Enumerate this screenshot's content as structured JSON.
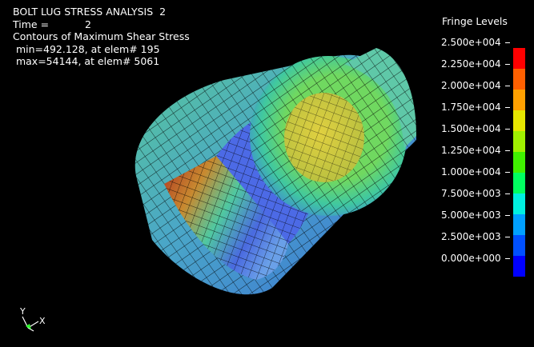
{
  "header": {
    "title": "BOLT LUG STRESS ANALYSIS  2",
    "time_label": "Time =",
    "time_value": "2",
    "contour_label": "Contours of Maximum Shear Stress",
    "min_text": " min=492.128, at elem# 195",
    "max_text": " max=54144, at elem# 5061"
  },
  "legend": {
    "title": "Fringe Levels",
    "levels": [
      "2.500e+004",
      "2.250e+004",
      "2.000e+004",
      "1.750e+004",
      "1.500e+004",
      "1.250e+004",
      "1.000e+004",
      "7.500e+003",
      "5.000e+003",
      "2.500e+003",
      "0.000e+000"
    ],
    "colors": [
      "#ff0000",
      "#ff6000",
      "#ffa000",
      "#e6e600",
      "#a0f000",
      "#40f000",
      "#00ff60",
      "#00f0e0",
      "#00a0ff",
      "#0050ff",
      "#0000ff"
    ]
  },
  "triad": {
    "y_label": "Y",
    "x_label": "X"
  }
}
